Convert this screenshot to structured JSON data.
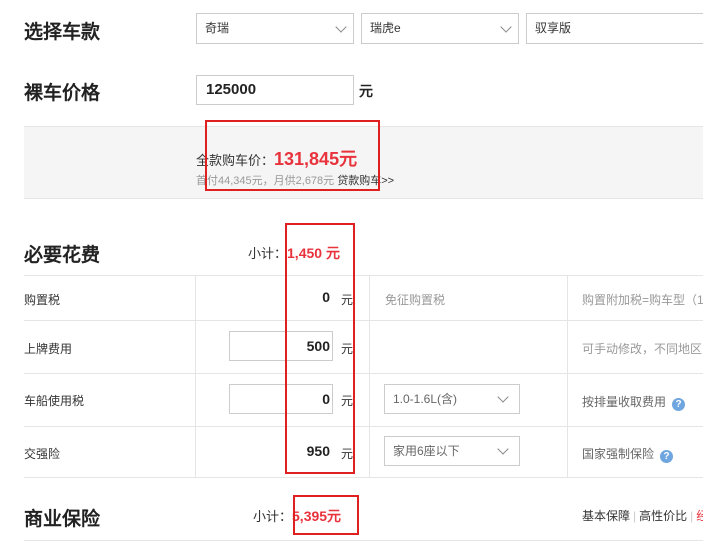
{
  "select_model": {
    "title": "选择车款",
    "brand": "奇瑞",
    "series": "瑞虎e",
    "trim": "驭享版"
  },
  "price": {
    "title": "裸车价格",
    "value": "125000",
    "unit": "元"
  },
  "summary": {
    "full_label": "全款购车价：",
    "full_value": "131,845元",
    "loan_text": "首付44,345元，月供2,678元",
    "loan_link": "贷款购车>>"
  },
  "required": {
    "title": "必要花费",
    "subtotal_label": "小计：",
    "subtotal_value": "1,450 元",
    "rows": [
      {
        "label": "购置税",
        "value": "0",
        "unit": "元",
        "option": "免征购置税",
        "note": "购置附加税=购车型（1"
      },
      {
        "label": "上牌费用",
        "value": "500",
        "unit": "元",
        "option": "",
        "note": "可手动修改，不同地区"
      },
      {
        "label": "车船使用税",
        "value": "0",
        "unit": "元",
        "option": "1.0-1.6L(含)",
        "note": "按排量收取费用"
      },
      {
        "label": "交强险",
        "value": "950",
        "unit": "元",
        "option": "家用6座以下",
        "note": "国家强制保险"
      }
    ]
  },
  "commercial": {
    "title": "商业保险",
    "subtotal_label": "小计：",
    "subtotal_value": "5,395元",
    "tab1": "基本保障",
    "tab2": "高性价比",
    "tab3": "经"
  },
  "colors": {
    "accent_red": "#e8323c",
    "box_red": "#e02020"
  }
}
